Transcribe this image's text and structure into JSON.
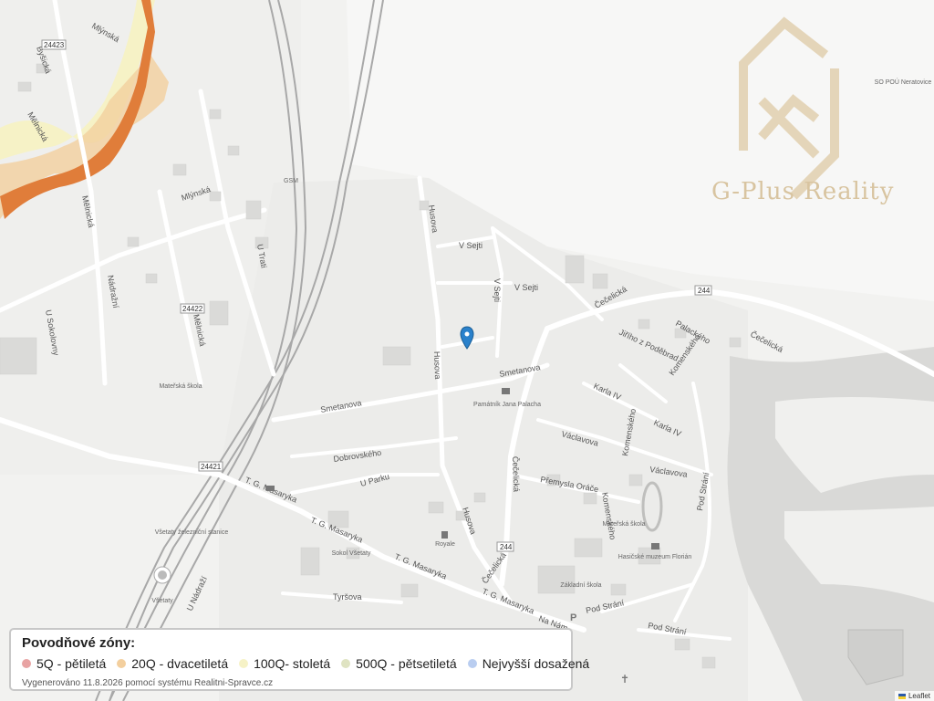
{
  "map": {
    "streets": {
      "bysicka": "Byšická",
      "mlynska": "Mlýnská",
      "melnicka": "Mělnická",
      "u_sokolovny": "U Sokolovny",
      "nadrazni": "Nádražní",
      "u_trati": "U Trati",
      "husova": "Husova",
      "v_sejti": "V Sejti",
      "smetanova": "Smetanova",
      "dobrovskeho": "Dobrovského",
      "u_parku": "U Parku",
      "tg_masaryka": "T. G. Masaryka",
      "tyrsova": "Tyršova",
      "cecelicka": "Čečelická",
      "jiriho": "Jiřího z Poděbrad",
      "palackeho": "Palackého",
      "komenskeho": "Komenského",
      "karla_iv": "Karla IV",
      "vaclavova": "Václavova",
      "premysla": "Přemysla Oráče",
      "pod_strani": "Pod Strání",
      "na_nam": "Na Nám",
      "u_nadrazi": "U Nádraží"
    },
    "road_numbers": [
      "24423",
      "24422",
      "24421",
      "244",
      "244",
      "244"
    ],
    "pois": {
      "materska1": "Mateřská škola",
      "gsm": "GSM",
      "pamatnik": "Památník Jana Palacha",
      "vsetaty_station": "Všetaty železniční stanice",
      "vsetaty": "Všetaty",
      "sokol": "Sokol Všetaty",
      "royale": "Royale",
      "materska2": "Mateřská škola",
      "muzeum": "Hasičské muzeum Florián",
      "zakladni": "Základní škola",
      "sopou": "SO POÚ Neratovice"
    },
    "watermark": "G-Plus Reality"
  },
  "legend": {
    "title": "Povodňové zóny:",
    "items": [
      {
        "label": "5Q - pětiletá",
        "color": "#e8a3a3"
      },
      {
        "label": "20Q - dvacetiletá",
        "color": "#f3cf9e"
      },
      {
        "label": "100Q- stoletá",
        "color": "#f6f2c6"
      },
      {
        "label": "500Q - pětsetiletá",
        "color": "#dfe3c2"
      },
      {
        "label": "Nejvyšší dosažená",
        "color": "#b9cdf0"
      }
    ],
    "note": "Vygenerováno 11.8.2026 pomocí systému Realitni-Spravce.cz"
  },
  "attribution": "Leaflet"
}
